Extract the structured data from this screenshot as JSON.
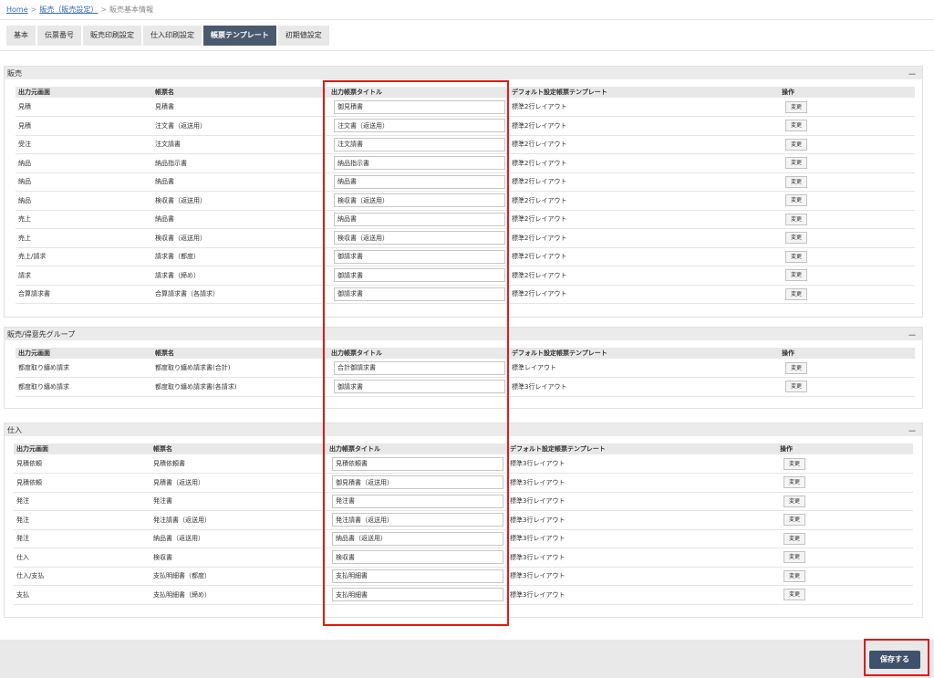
{
  "breadcrumb": {
    "home": "Home",
    "parent": "販売（販売設定）",
    "current": "販売基本情報",
    "sep": ">"
  },
  "tabs": [
    {
      "label": "基本",
      "active": false
    },
    {
      "label": "伝票番号",
      "active": false
    },
    {
      "label": "販売印刷設定",
      "active": false
    },
    {
      "label": "仕入印刷設定",
      "active": false
    },
    {
      "label": "帳票テンプレート",
      "active": true
    },
    {
      "label": "初期値設定",
      "active": false
    }
  ],
  "columns": {
    "source": "出力元画面",
    "name": "帳票名",
    "title": "出力帳票タイトル",
    "template": "デフォルト設定帳票テンプレート",
    "action": "操作"
  },
  "change_label": "変更",
  "collapse_symbol": "－",
  "save_label": "保存する",
  "sections": [
    {
      "title": "販売",
      "rows": [
        {
          "source": "見積",
          "name": "見積書",
          "title": "御見積書",
          "template": "標準2行レイアウト"
        },
        {
          "source": "見積",
          "name": "注文書（返送用）",
          "title": "注文書（返送用）",
          "template": "標準2行レイアウト"
        },
        {
          "source": "受注",
          "name": "注文請書",
          "title": "注文請書",
          "template": "標準2行レイアウト"
        },
        {
          "source": "納品",
          "name": "納品指示書",
          "title": "納品指示書",
          "template": "標準2行レイアウト"
        },
        {
          "source": "納品",
          "name": "納品書",
          "title": "納品書",
          "template": "標準2行レイアウト"
        },
        {
          "source": "納品",
          "name": "検収書（返送用）",
          "title": "検収書（返送用）",
          "template": "標準2行レイアウト"
        },
        {
          "source": "売上",
          "name": "納品書",
          "title": "納品書",
          "template": "標準2行レイアウト"
        },
        {
          "source": "売上",
          "name": "検収書（返送用）",
          "title": "検収書（返送用）",
          "template": "標準2行レイアウト"
        },
        {
          "source": "売上/請求",
          "name": "請求書（都度）",
          "title": "御請求書",
          "template": "標準2行レイアウト"
        },
        {
          "source": "請求",
          "name": "請求書（締め）",
          "title": "御請求書",
          "template": "標準2行レイアウト"
        },
        {
          "source": "合算請求書",
          "name": "合算請求書（各請求）",
          "title": "御請求書",
          "template": "標準2行レイアウト"
        }
      ]
    },
    {
      "title": "販売/得意先グループ",
      "rows": [
        {
          "source": "都度取り纏め請求",
          "name": "都度取り纏め請求書(合計)",
          "title": "合計御請求書",
          "template": "標準レイアウト"
        },
        {
          "source": "都度取り纏め請求",
          "name": "都度取り纏め請求書(各請求)",
          "title": "御請求書",
          "template": "標準3行レイアウト"
        }
      ]
    },
    {
      "title": "仕入",
      "rows": [
        {
          "source": "見積依頼",
          "name": "見積依頼書",
          "title": "見積依頼書",
          "template": "標準3行レイアウト"
        },
        {
          "source": "見積依頼",
          "name": "見積書（返送用）",
          "title": "御見積書（返送用）",
          "template": "標準3行レイアウト"
        },
        {
          "source": "発注",
          "name": "発注書",
          "title": "発注書",
          "template": "標準3行レイアウト"
        },
        {
          "source": "発注",
          "name": "発注請書（返送用）",
          "title": "発注請書（返送用）",
          "template": "標準3行レイアウト"
        },
        {
          "source": "発注",
          "name": "納品書（返送用）",
          "title": "納品書（返送用）",
          "template": "標準3行レイアウト"
        },
        {
          "source": "仕入",
          "name": "検収書",
          "title": "検収書",
          "template": "標準3行レイアウト"
        },
        {
          "source": "仕入/支払",
          "name": "支払明細書（都度）",
          "title": "支払明細書",
          "template": "標準3行レイアウト"
        },
        {
          "source": "支払",
          "name": "支払明細書（締め）",
          "title": "支払明細書",
          "template": "標準3行レイアウト"
        }
      ]
    }
  ],
  "highlight_color": "#e01919",
  "accent_color": "#4a5a6e"
}
